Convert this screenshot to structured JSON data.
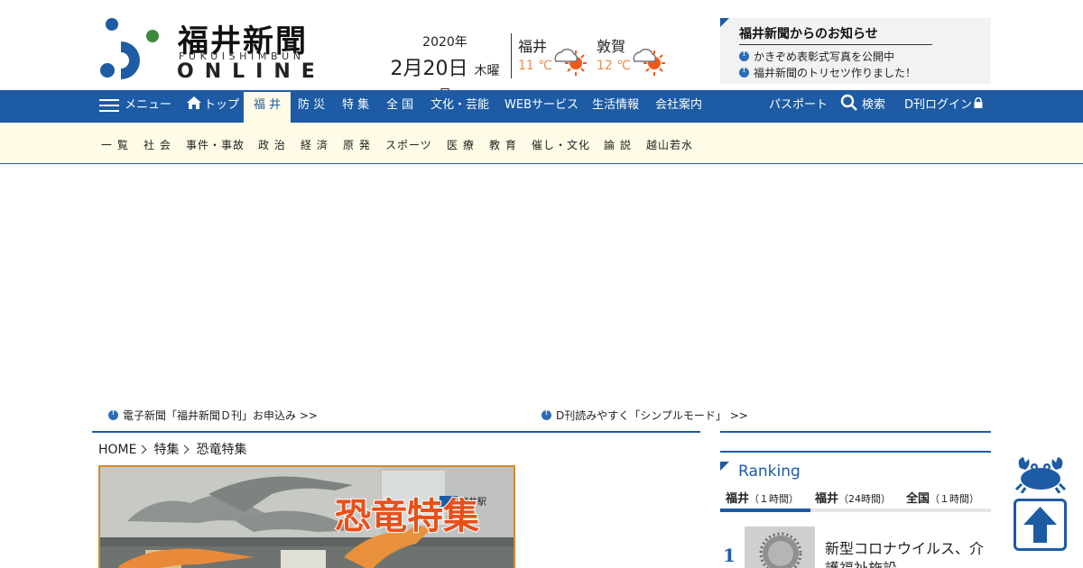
{
  "brand": {
    "name": "福井新聞",
    "roman": "FUKUISHIMBUN",
    "online": "ONLINE",
    "colors": {
      "mark_blue": "#1d5ba4",
      "mark_green": "#3a8a3a"
    }
  },
  "date": {
    "year": "2020年",
    "month_day": "2月20日",
    "weekday": "木曜日"
  },
  "weather": [
    {
      "city": "福井",
      "temp": "11 ℃",
      "icon": "cloudy-sunny-icon"
    },
    {
      "city": "敦賀",
      "temp": "12 ℃",
      "icon": "cloudy-sunny-icon"
    }
  ],
  "notice": {
    "title": "福井新聞からのお知らせ",
    "items": [
      "かきぞめ表彰式写真を公開中",
      "福井新聞のトリセツ作りました！"
    ]
  },
  "nav": {
    "menu": "メニュー",
    "top": "トップ",
    "items": [
      "福 井",
      "防 災",
      "特 集",
      "全 国",
      "文化・芸能",
      "WEBサービス",
      "生活情報",
      "会社案内"
    ],
    "active": "福 井",
    "passport": "パスポート",
    "search": "検索",
    "login": "D刊ログイン"
  },
  "subnav": [
    "一 覧",
    "社 会",
    "事件・事故",
    "政 治",
    "経 済",
    "原 発",
    "スポーツ",
    "医 療",
    "教 育",
    "催し・文化",
    "論 説",
    "越山若水"
  ],
  "links": [
    "電子新聞「福井新聞Ｄ刊」お申込み >>",
    "D刊読みやすく「シンプルモード」 >>"
  ],
  "breadcrumb": [
    "HOME",
    "特集",
    "恐竜特集"
  ],
  "hero": {
    "title": "恐竜特集",
    "sign": "福井駅"
  },
  "ranking": {
    "title": "Ranking",
    "tabs": [
      {
        "label": "福井",
        "sub": "（１時間）"
      },
      {
        "label": "福井",
        "sub": "（24時間）"
      },
      {
        "label": "全国",
        "sub": "（１時間）"
      }
    ],
    "items": [
      {
        "rank": "1",
        "text": "新型コロナウイルス、介護福祉施設"
      }
    ]
  },
  "colors": {
    "primary": "#1d5ba4",
    "subnav_bg": "#fffbe6",
    "temp": "#ef8a4a",
    "hero_border": "#d48a2a"
  }
}
